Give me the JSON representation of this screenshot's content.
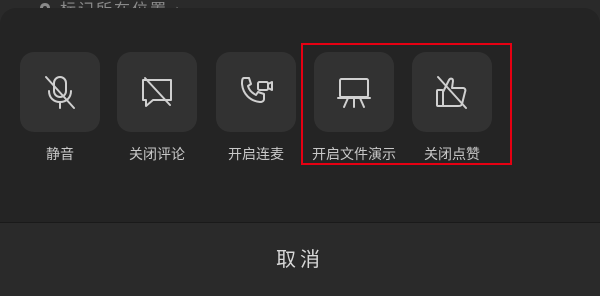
{
  "top_bar": {
    "location_text": "标记所在位置 ›",
    "icon": "location-pin-icon"
  },
  "actions": [
    {
      "label": "静音",
      "icon": "mic-off-icon"
    },
    {
      "label": "关闭评论",
      "icon": "comment-off-icon"
    },
    {
      "label": "开启连麦",
      "icon": "phone-video-icon"
    },
    {
      "label": "开启文件演示",
      "icon": "presentation-board-icon"
    },
    {
      "label": "关闭点赞",
      "icon": "thumbs-up-off-icon"
    }
  ],
  "cancel_label": "取消",
  "colors": {
    "background": "#151515",
    "sheet": "#242424",
    "tile": "#323232",
    "icon": "#d0d0d0",
    "highlight": "#e60012"
  }
}
